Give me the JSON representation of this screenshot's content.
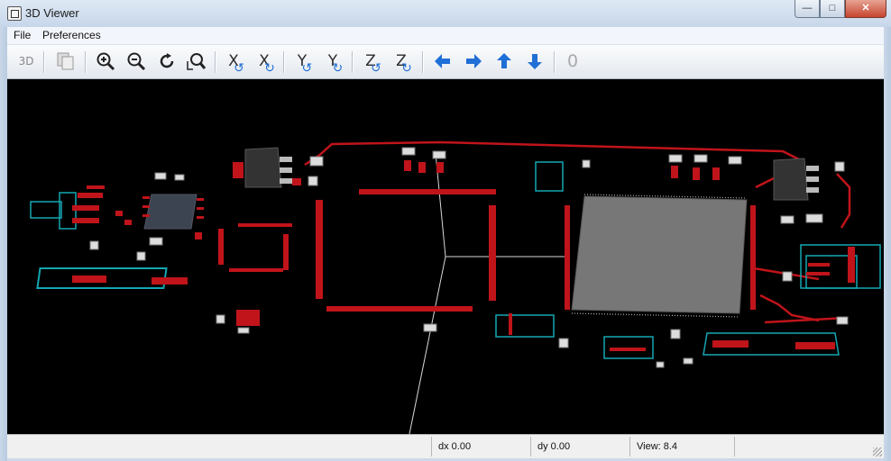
{
  "window": {
    "title": "3D Viewer",
    "minimize": "—",
    "maximize": "□",
    "close": "✕"
  },
  "menu": {
    "items": [
      "File",
      "Preferences"
    ]
  },
  "toolbar": {
    "buttons": [
      {
        "name": "reload-3d-button",
        "icon": "reload-3d-icon"
      },
      {
        "name": "copy-image-button",
        "icon": "copy-icon"
      },
      {
        "name": "zoom-in-button",
        "icon": "zoom-in-icon"
      },
      {
        "name": "zoom-out-button",
        "icon": "zoom-out-icon"
      },
      {
        "name": "redraw-button",
        "icon": "refresh-icon"
      },
      {
        "name": "zoom-fit-button",
        "icon": "zoom-fit-icon"
      },
      {
        "name": "rotate-x-ccw-button",
        "icon": "rotate-x-ccw-icon",
        "letter": "X"
      },
      {
        "name": "rotate-x-cw-button",
        "icon": "rotate-x-cw-icon",
        "letter": "X"
      },
      {
        "name": "rotate-y-ccw-button",
        "icon": "rotate-y-ccw-icon",
        "letter": "Y"
      },
      {
        "name": "rotate-y-cw-button",
        "icon": "rotate-y-cw-icon",
        "letter": "Y"
      },
      {
        "name": "rotate-z-ccw-button",
        "icon": "rotate-z-ccw-icon",
        "letter": "Z"
      },
      {
        "name": "rotate-z-cw-button",
        "icon": "rotate-z-cw-icon",
        "letter": "Z"
      },
      {
        "name": "move-left-button",
        "icon": "arrow-left-icon"
      },
      {
        "name": "move-right-button",
        "icon": "arrow-right-icon"
      },
      {
        "name": "move-up-button",
        "icon": "arrow-up-icon"
      },
      {
        "name": "move-down-button",
        "icon": "arrow-down-icon"
      },
      {
        "name": "ortho-toggle-button",
        "icon": "ortho-icon",
        "label": "0"
      }
    ],
    "reload_label": "3D"
  },
  "status": {
    "dx": "dx 0.00",
    "dy": "dy 0.00",
    "view": "View: 8.4"
  },
  "colors": {
    "board_bg": "#000000",
    "copper": "#c0141a",
    "silk": "#14a7b3",
    "axis": "#d9d9d9",
    "ic_body": "#777777",
    "accent_blue": "#1f6fd6"
  }
}
